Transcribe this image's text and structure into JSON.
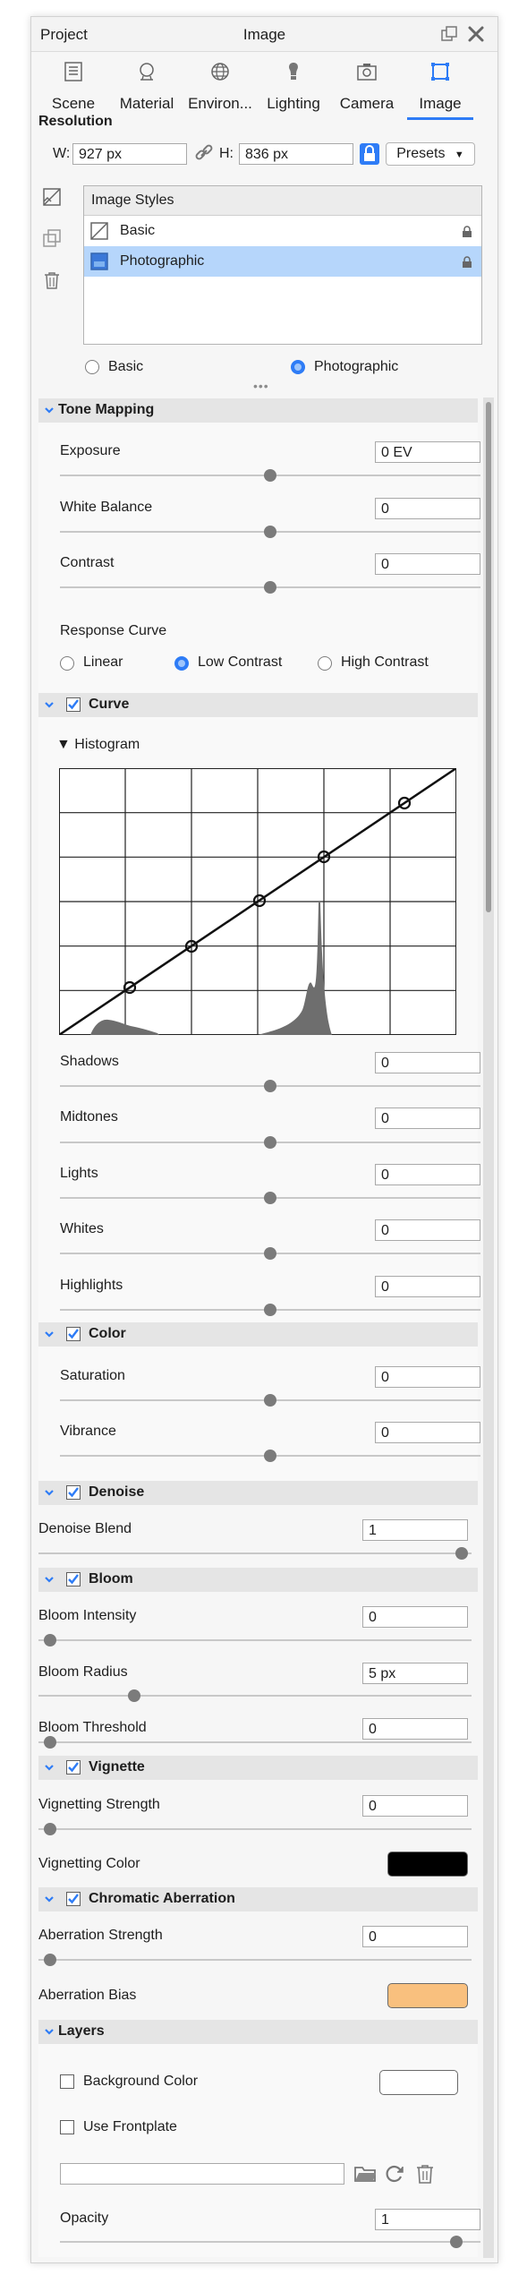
{
  "window": {
    "left_title": "Project",
    "center_title": "Image"
  },
  "tabs": [
    {
      "label": "Scene",
      "icon": "scene-icon"
    },
    {
      "label": "Material",
      "icon": "material-icon"
    },
    {
      "label": "Environ...",
      "icon": "environment-icon"
    },
    {
      "label": "Lighting",
      "icon": "lighting-icon"
    },
    {
      "label": "Camera",
      "icon": "camera-icon"
    },
    {
      "label": "Image",
      "icon": "image-icon",
      "active": true
    }
  ],
  "resolution": {
    "title": "Resolution",
    "w_label": "W:",
    "w_value": "927 px",
    "h_label": "H:",
    "h_value": "836 px",
    "presets_label": "Presets"
  },
  "image_styles": {
    "header": "Image Styles",
    "items": [
      {
        "label": "Basic",
        "selected": false
      },
      {
        "label": "Photographic",
        "selected": true
      }
    ]
  },
  "style_radio": {
    "basic": "Basic",
    "photographic": "Photographic",
    "selected": "photographic"
  },
  "tone_mapping": {
    "title": "Tone Mapping",
    "exposure_label": "Exposure",
    "exposure_value": "0 EV",
    "white_balance_label": "White Balance",
    "white_balance_value": "0",
    "contrast_label": "Contrast",
    "contrast_value": "0",
    "response_curve_label": "Response Curve",
    "curve_options": [
      "Linear",
      "Low Contrast",
      "High Contrast"
    ],
    "curve_selected": "Low Contrast"
  },
  "curve": {
    "title": "Curve",
    "histogram_label": "▼ Histogram",
    "shadows_label": "Shadows",
    "shadows_value": "0",
    "midtones_label": "Midtones",
    "midtones_value": "0",
    "lights_label": "Lights",
    "lights_value": "0",
    "whites_label": "Whites",
    "whites_value": "0",
    "highlights_label": "Highlights",
    "highlights_value": "0"
  },
  "color": {
    "title": "Color",
    "saturation_label": "Saturation",
    "saturation_value": "0",
    "vibrance_label": "Vibrance",
    "vibrance_value": "0"
  },
  "denoise": {
    "title": "Denoise",
    "blend_label": "Denoise Blend",
    "blend_value": "1"
  },
  "bloom": {
    "title": "Bloom",
    "intensity_label": "Bloom Intensity",
    "intensity_value": "0",
    "radius_label": "Bloom Radius",
    "radius_value": "5 px",
    "threshold_label": "Bloom Threshold",
    "threshold_value": "0"
  },
  "vignette": {
    "title": "Vignette",
    "strength_label": "Vignetting Strength",
    "strength_value": "0",
    "color_label": "Vignetting Color",
    "color_hex": "#000000"
  },
  "chromatic_aberration": {
    "title": "Chromatic Aberration",
    "strength_label": "Aberration Strength",
    "strength_value": "0",
    "bias_label": "Aberration Bias",
    "bias_color_hex": "#f9c07e"
  },
  "layers": {
    "title": "Layers",
    "background_color_label": "Background Color",
    "use_frontplate_label": "Use Frontplate",
    "frontplate_path": "",
    "opacity_label": "Opacity",
    "opacity_value": "1"
  },
  "colors": {
    "accent": "#2e7cf6",
    "selection": "#b6d6fb",
    "section_header": "#e5e5e5"
  }
}
